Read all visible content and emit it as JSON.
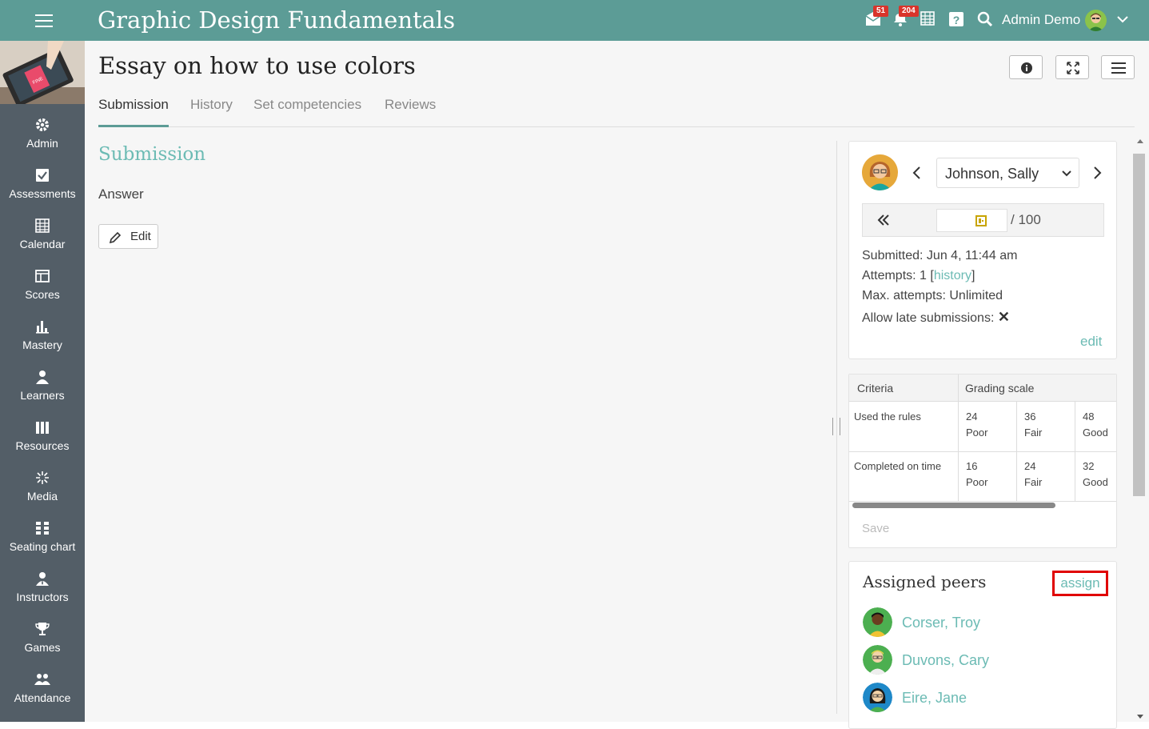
{
  "header": {
    "course_title": "Graphic Design Fundamentals",
    "messages_count": "51",
    "notifications_count": "204",
    "user_name": "Admin Demo"
  },
  "sidebar": {
    "items": [
      {
        "label": "Admin",
        "icon": "gear-icon"
      },
      {
        "label": "Assessments",
        "icon": "checkbox-icon"
      },
      {
        "label": "Calendar",
        "icon": "calendar-icon"
      },
      {
        "label": "Scores",
        "icon": "scores-icon"
      },
      {
        "label": "Mastery",
        "icon": "bar-chart-icon"
      },
      {
        "label": "Learners",
        "icon": "person-icon"
      },
      {
        "label": "Resources",
        "icon": "books-icon"
      },
      {
        "label": "Media",
        "icon": "media-icon"
      },
      {
        "label": "Seating chart",
        "icon": "seating-icon"
      },
      {
        "label": "Instructors",
        "icon": "instructor-icon"
      },
      {
        "label": "Games",
        "icon": "trophy-icon"
      },
      {
        "label": "Attendance",
        "icon": "group-icon"
      }
    ]
  },
  "page": {
    "title": "Essay on how to use colors",
    "tabs": [
      "Submission",
      "History",
      "Set competencies",
      "Reviews"
    ],
    "active_tab": "Submission"
  },
  "submission": {
    "heading": "Submission",
    "answer_label": "Answer",
    "edit_label": "Edit"
  },
  "grading": {
    "student": "Johnson, Sally",
    "score_max": "/ 100",
    "submitted": "Submitted: Jun 4, 11:44 am",
    "attempts_prefix": "Attempts: 1 [",
    "attempts_link": "history",
    "attempts_suffix": "]",
    "max_attempts": "Max. attempts: Unlimited",
    "late_label": "Allow late submissions:",
    "late_value": "✕",
    "edit_link": "edit"
  },
  "rubric": {
    "col_criteria": "Criteria",
    "col_scale": "Grading scale",
    "rows": [
      {
        "criteria": "Used the rules",
        "levels": [
          {
            "points": "24",
            "label": "Poor"
          },
          {
            "points": "36",
            "label": "Fair"
          },
          {
            "points": "48",
            "label": "Good"
          }
        ]
      },
      {
        "criteria": "Completed on time",
        "levels": [
          {
            "points": "16",
            "label": "Poor"
          },
          {
            "points": "24",
            "label": "Fair"
          },
          {
            "points": "32",
            "label": "Good"
          }
        ]
      }
    ],
    "save_label": "Save"
  },
  "peers": {
    "title": "Assigned peers",
    "assign_label": "assign",
    "list": [
      {
        "name": "Corser, Troy",
        "avatar_color": "#4caf50"
      },
      {
        "name": "Duvons, Cary",
        "avatar_color": "#4caf50"
      },
      {
        "name": "Eire, Jane",
        "avatar_color": "#1e88c8"
      }
    ]
  },
  "colors": {
    "header": "#5c9c96",
    "sidebar": "#535e67",
    "accent": "#6cbbb4",
    "highlight_box": "#e00000"
  }
}
